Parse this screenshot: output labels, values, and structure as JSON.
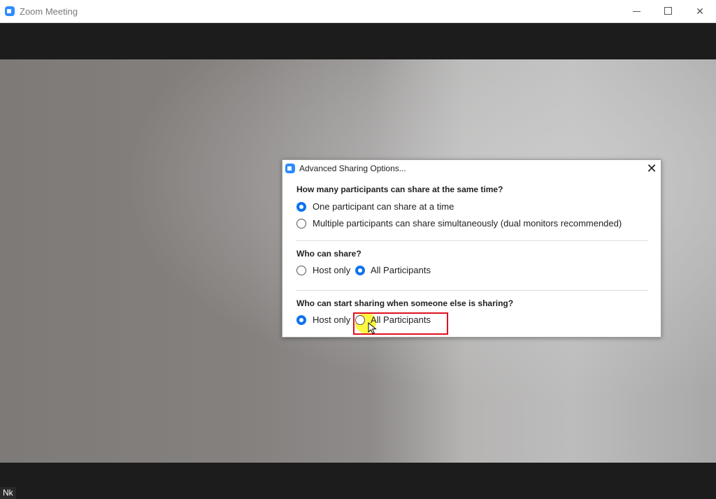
{
  "window": {
    "title": "Zoom Meeting",
    "icon": "zoom-logo-icon",
    "controls": {
      "minimize": "minimize-icon",
      "maximize": "maximize-icon",
      "close": "✕"
    }
  },
  "video": {
    "participant_name": "Nk"
  },
  "dialog": {
    "title": "Advanced Sharing Options...",
    "close_label": "✕",
    "sections": [
      {
        "question": "How many participants can share at the same time?",
        "options": [
          {
            "label": "One participant can share at a time",
            "selected": true
          },
          {
            "label": "Multiple participants can share simultaneously (dual monitors recommended)",
            "selected": false
          }
        ]
      },
      {
        "question": "Who can share?",
        "options": [
          {
            "label": "Host only",
            "selected": false
          },
          {
            "label": "All Participants",
            "selected": true
          }
        ]
      },
      {
        "question": "Who can start sharing when someone else is sharing?",
        "options": [
          {
            "label": "Host only",
            "selected": true
          },
          {
            "label": "All Participants",
            "selected": false
          }
        ]
      }
    ]
  },
  "colors": {
    "accent": "#0e72ed",
    "highlight_box": "#e01020",
    "cursor_glow": "#fff500",
    "zoom_blue": "#2d8cff"
  }
}
